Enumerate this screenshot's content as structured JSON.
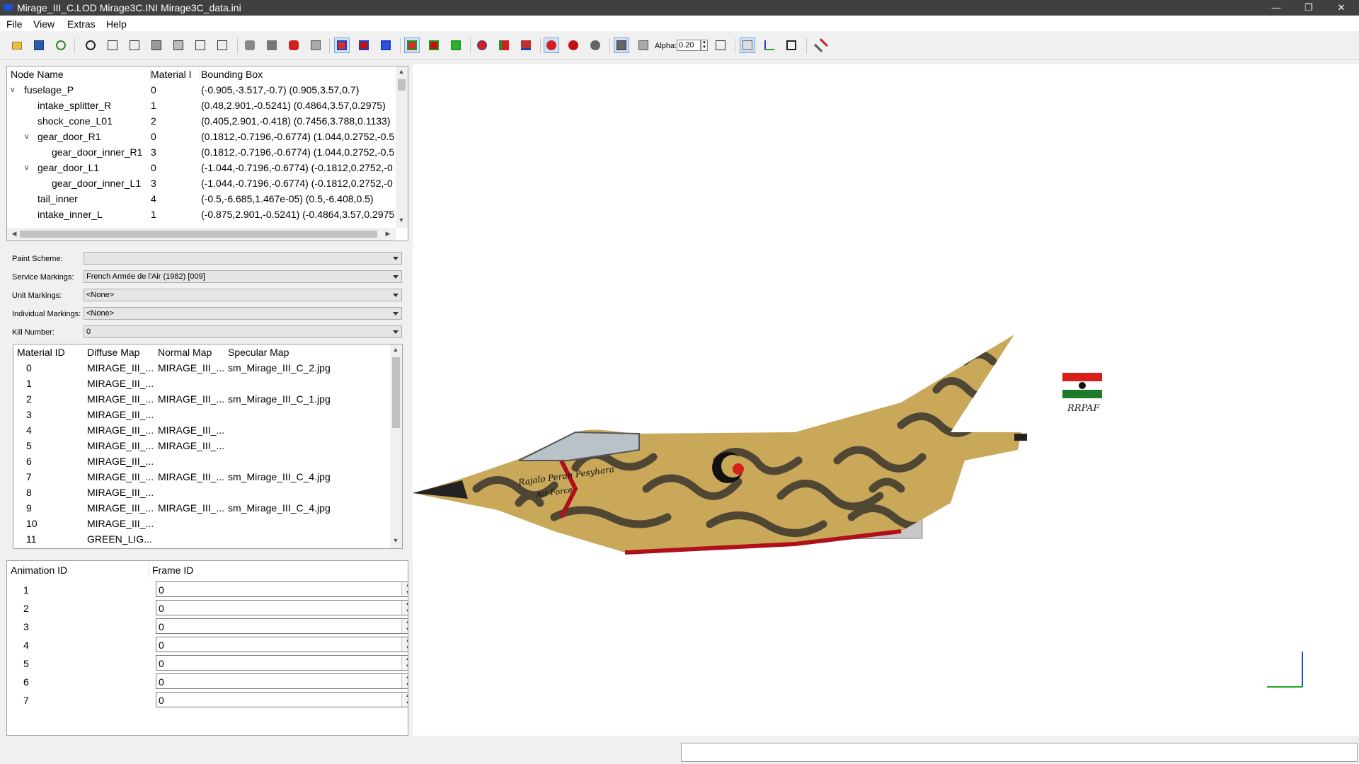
{
  "window": {
    "title": "Mirage_III_C.LOD  Mirage3C.INI  Mirage3C_data.ini",
    "controls": {
      "minimize": "—",
      "maximize": "❐",
      "close": "✕"
    }
  },
  "menu": [
    "File",
    "View",
    "Extras",
    "Help"
  ],
  "toolbar": {
    "alpha_label": "Alpha:",
    "alpha_value": "0.20"
  },
  "node_table": {
    "columns": [
      "Node Name",
      "Material I",
      "Bounding Box"
    ],
    "rows": [
      {
        "name": "fuselage_P",
        "material": "0",
        "bbox": "(-0.905,-3.517,-0.7) (0.905,3.57,0.7)",
        "toggle": "v"
      },
      {
        "name": "intake_splitter_R",
        "material": "1",
        "bbox": "(0.48,2.901,-0.5241) (0.4864,3.57,0.2975)",
        "toggle": ""
      },
      {
        "name": "shock_cone_L01",
        "material": "2",
        "bbox": "(0.405,2.901,-0.418) (0.7456,3.788,0.1133)",
        "toggle": ""
      },
      {
        "name": "gear_door_R1",
        "material": "0",
        "bbox": "(0.1812,-0.7196,-0.6774) (1.044,0.2752,-0.5",
        "toggle": "v"
      },
      {
        "name": "gear_door_inner_R1",
        "material": "3",
        "bbox": "(0.1812,-0.7196,-0.6774) (1.044,0.2752,-0.5",
        "toggle": ""
      },
      {
        "name": "gear_door_L1",
        "material": "0",
        "bbox": "(-1.044,-0.7196,-0.6774) (-0.1812,0.2752,-0",
        "toggle": "v"
      },
      {
        "name": "gear_door_inner_L1",
        "material": "3",
        "bbox": "(-1.044,-0.7196,-0.6774) (-0.1812,0.2752,-0",
        "toggle": ""
      },
      {
        "name": "tail_inner",
        "material": "4",
        "bbox": "(-0.5,-6.685,1.467e-05) (0.5,-6.408,0.5)",
        "toggle": ""
      },
      {
        "name": "intake_inner_L",
        "material": "1",
        "bbox": "(-0.875,2.901,-0.5241) (-0.4864,3.57,0.2975",
        "toggle": ""
      }
    ]
  },
  "markings": {
    "paint_scheme": {
      "label": "Paint Scheme:",
      "value": ""
    },
    "service": {
      "label": "Service Markings:",
      "value": "French Armée de l'Air (1982) [009]"
    },
    "unit": {
      "label": "Unit Markings:",
      "value": "<None>"
    },
    "individual": {
      "label": "Individual Markings:",
      "value": "<None>"
    },
    "kill": {
      "label": "Kill Number:",
      "value": "0"
    }
  },
  "material_table": {
    "columns": [
      "Material ID",
      "Diffuse Map",
      "Normal Map",
      "Specular Map"
    ],
    "rows": [
      {
        "id": "0",
        "diffuse": "MIRAGE_III_...",
        "normal": "MIRAGE_III_...",
        "specular": "sm_Mirage_III_C_2.jpg"
      },
      {
        "id": "1",
        "diffuse": "MIRAGE_III_...",
        "normal": "",
        "specular": ""
      },
      {
        "id": "2",
        "diffuse": "MIRAGE_III_...",
        "normal": "MIRAGE_III_...",
        "specular": "sm_Mirage_III_C_1.jpg"
      },
      {
        "id": "3",
        "diffuse": "MIRAGE_III_...",
        "normal": "",
        "specular": ""
      },
      {
        "id": "4",
        "diffuse": "MIRAGE_III_...",
        "normal": "MIRAGE_III_...",
        "specular": ""
      },
      {
        "id": "5",
        "diffuse": "MIRAGE_III_...",
        "normal": "MIRAGE_III_...",
        "specular": ""
      },
      {
        "id": "6",
        "diffuse": "MIRAGE_III_...",
        "normal": "",
        "specular": ""
      },
      {
        "id": "7",
        "diffuse": "MIRAGE_III_...",
        "normal": "MIRAGE_III_...",
        "specular": "sm_Mirage_III_C_4.jpg"
      },
      {
        "id": "8",
        "diffuse": "MIRAGE_III_...",
        "normal": "",
        "specular": ""
      },
      {
        "id": "9",
        "diffuse": "MIRAGE_III_...",
        "normal": "MIRAGE_III_...",
        "specular": "sm_Mirage_III_C_4.jpg"
      },
      {
        "id": "10",
        "diffuse": "MIRAGE_III_...",
        "normal": "",
        "specular": ""
      },
      {
        "id": "11",
        "diffuse": "GREEN_LIG...",
        "normal": "",
        "specular": ""
      }
    ]
  },
  "animation_table": {
    "columns": [
      "Animation ID",
      "Frame ID"
    ],
    "rows": [
      {
        "id": "1",
        "frame": "0"
      },
      {
        "id": "2",
        "frame": "0"
      },
      {
        "id": "3",
        "frame": "0"
      },
      {
        "id": "4",
        "frame": "0"
      },
      {
        "id": "5",
        "frame": "0"
      },
      {
        "id": "6",
        "frame": "0"
      },
      {
        "id": "7",
        "frame": "0"
      }
    ]
  },
  "viewport": {
    "nose_text": "Rajalo Peran Pesyhara",
    "nose_text2": "Air Force",
    "tail_text": "RRPAF"
  },
  "colors": {
    "camo_sand": "#c9a85a",
    "camo_dark": "#4f4733",
    "trim_red": "#b0101a",
    "flag_red": "#d8201a",
    "flag_green": "#1f7a2a",
    "axis_blue": "#1a4fd0",
    "axis_green": "#22aa22",
    "titlebar": "#404040"
  }
}
